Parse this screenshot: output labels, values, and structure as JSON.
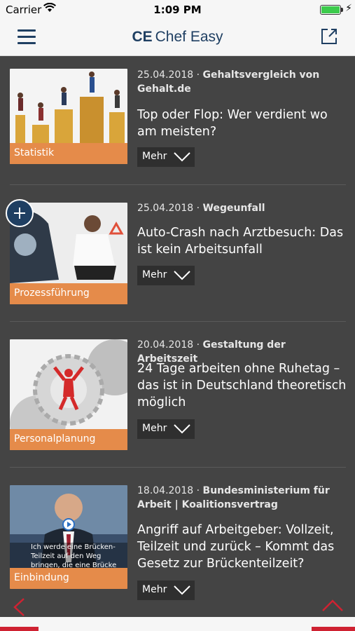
{
  "status": {
    "carrier": "Carrier",
    "time": "1:09 PM"
  },
  "nav": {
    "title_bold": "CE",
    "title_rest": "Chef Easy"
  },
  "more_label": "Mehr",
  "articles": [
    {
      "date": "25.04.2018",
      "source": "Gehaltsvergleich von Gehalt.de",
      "headline": "Top oder Flop: Wer verdient wo am meisten?",
      "category": "Statistik"
    },
    {
      "date": "25.04.2018",
      "source": "Wegeunfall",
      "headline": "Auto-Crash nach Arztbesuch: Das ist kein Arbeitsunfall",
      "category": "Prozessführung"
    },
    {
      "date": "20.04.2018",
      "source": "Gestaltung der Arbeitszeit",
      "headline": "24 Tage arbeiten ohne Ruhetag – das ist in Deutschland theoretisch möglich",
      "category": "Personalplanung"
    },
    {
      "date": "18.04.2018",
      "source": "Bundesministerium für Arbeit | Koalitionsvertrag",
      "headline": "Angriff auf Arbeitgeber: Vollzeit, Teilzeit und zurück – Kommt das Gesetz zur Brückenteilzeit?",
      "category": "Einbindung",
      "caption": "Ich werde eine Brücken-Teilzeit auf den Weg bringen, die eine Brücke"
    }
  ],
  "colors": {
    "navy": "#1f3f62",
    "orange": "#e58b4a",
    "red": "#cf2232"
  }
}
